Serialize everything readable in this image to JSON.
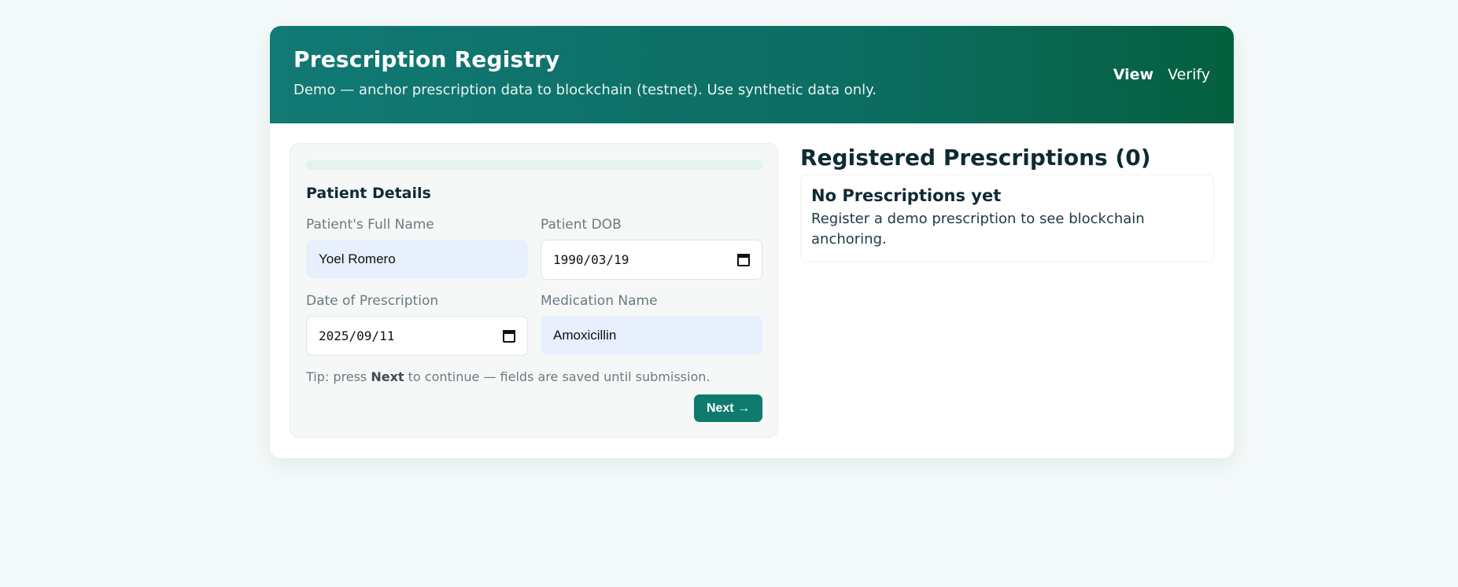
{
  "header": {
    "title": "Prescription Registry",
    "subtitle": "Demo — anchor prescription data to blockchain (testnet). Use synthetic data only.",
    "nav": [
      {
        "label": "View",
        "active": true
      },
      {
        "label": "Verify",
        "active": false
      }
    ]
  },
  "form": {
    "progress": 0,
    "section_title": "Patient Details",
    "fields": {
      "full_name": {
        "label": "Patient's Full Name",
        "value": "Yoel Romero"
      },
      "dob": {
        "label": "Patient DOB",
        "value": "1990/03/19"
      },
      "prescription_date": {
        "label": "Date of Prescription",
        "value": "2025/09/11"
      },
      "medication": {
        "label": "Medication Name",
        "value": "Amoxicillin"
      }
    },
    "tip": {
      "prefix": "Tip: press ",
      "bold": "Next",
      "suffix": " to continue — fields are saved until submission."
    },
    "next_label": "Next →"
  },
  "registry": {
    "title": "Registered Prescriptions (0)",
    "empty_title": "No Prescriptions yet",
    "empty_text": "Register a demo prescription to see blockchain anchoring."
  },
  "colors": {
    "accent": "#0f7a6e",
    "header_gradient_start": "#127975",
    "header_gradient_end": "#05603f",
    "autofill_bg": "#e8f0fe"
  }
}
